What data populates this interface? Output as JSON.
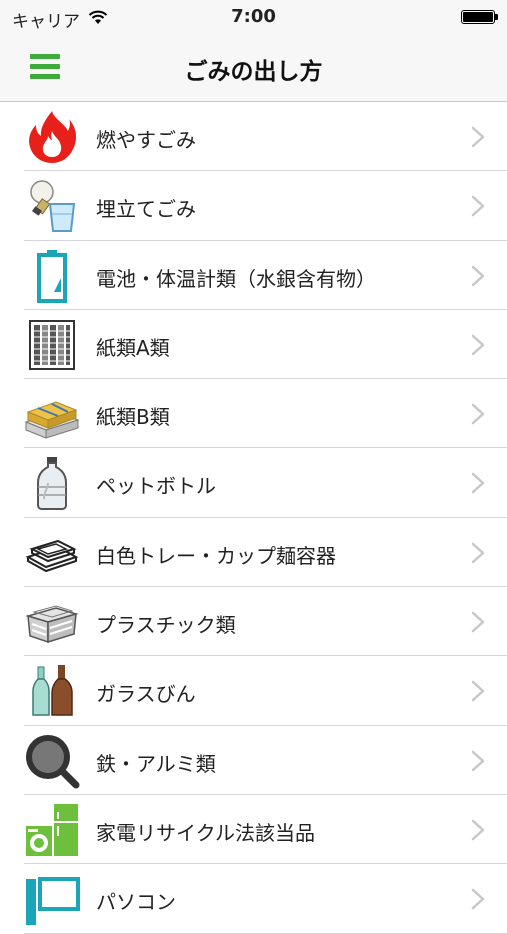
{
  "status_bar": {
    "carrier": "キャリア",
    "time": "7:00"
  },
  "nav": {
    "title": "ごみの出し方"
  },
  "items": [
    {
      "label": "燃やすごみ",
      "icon": "flame-icon"
    },
    {
      "label": "埋立てごみ",
      "icon": "lightbulb-glass-icon"
    },
    {
      "label": "電池・体温計類（水銀含有物）",
      "icon": "battery-icon"
    },
    {
      "label": "紙類A類",
      "icon": "paper-box-icon"
    },
    {
      "label": "紙類B類",
      "icon": "newspaper-bundle-icon"
    },
    {
      "label": "ペットボトル",
      "icon": "pet-bottle-icon"
    },
    {
      "label": "白色トレー・カップ麺容器",
      "icon": "white-tray-icon"
    },
    {
      "label": "プラスチック類",
      "icon": "plastic-container-icon"
    },
    {
      "label": "ガラスびん",
      "icon": "glass-bottles-icon"
    },
    {
      "label": "鉄・アルミ類",
      "icon": "frying-pan-icon"
    },
    {
      "label": "家電リサイクル法該当品",
      "icon": "home-appliances-icon"
    },
    {
      "label": "パソコン",
      "icon": "computer-icon"
    }
  ],
  "colors": {
    "accent": "#3daa3a",
    "flame": "#e8201a",
    "battery": "#1aa6b8",
    "appliance": "#6dbf3c",
    "chevron": "#c7c7cc"
  }
}
